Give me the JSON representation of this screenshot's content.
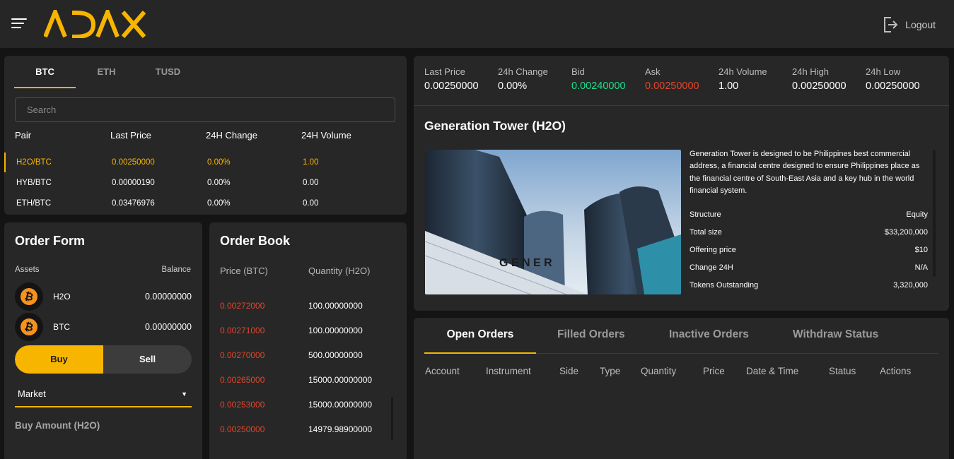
{
  "app": {
    "brand": "ADAX",
    "logout_label": "Logout",
    "accent": "#f7b500",
    "up_color": "#1ae08a",
    "down_color": "#e2452b"
  },
  "markets": {
    "tabs": [
      "BTC",
      "ETH",
      "TUSD"
    ],
    "active_tab": "BTC",
    "search_placeholder": "Search",
    "columns": [
      "Pair",
      "Last Price",
      "24H Change",
      "24H Volume"
    ],
    "rows": [
      {
        "pair": "H2O/BTC",
        "last_price": "0.00250000",
        "change": "0.00%",
        "volume": "1.00"
      },
      {
        "pair": "HYB/BTC",
        "last_price": "0.00000190",
        "change": "0.00%",
        "volume": "0.00"
      },
      {
        "pair": "ETH/BTC",
        "last_price": "0.03476976",
        "change": "0.00%",
        "volume": "0.00"
      }
    ]
  },
  "order_form": {
    "title": "Order Form",
    "assets_label": "Assets",
    "balance_label": "Balance",
    "assets": [
      {
        "icon": "bitcoin-icon",
        "name": "H2O",
        "balance": "0.00000000"
      },
      {
        "icon": "bitcoin-icon",
        "name": "BTC",
        "balance": "0.00000000"
      }
    ],
    "buy_label": "Buy",
    "sell_label": "Sell",
    "order_type": "Market",
    "buy_amount_label": "Buy Amount (H2O)"
  },
  "order_book": {
    "title": "Order Book",
    "price_header": "Price (BTC)",
    "qty_header": "Quantity (H2O)",
    "rows": [
      {
        "price": "0.00272000",
        "qty": "100.00000000"
      },
      {
        "price": "0.00271000",
        "qty": "100.00000000"
      },
      {
        "price": "0.00270000",
        "qty": "500.00000000"
      },
      {
        "price": "0.00265000",
        "qty": "15000.00000000"
      },
      {
        "price": "0.00253000",
        "qty": "15000.00000000"
      },
      {
        "price": "0.00250000",
        "qty": "14979.98900000"
      }
    ]
  },
  "ticker": {
    "last_price": {
      "label": "Last Price",
      "value": "0.00250000"
    },
    "change_24h": {
      "label": "24h Change",
      "value": "0.00%"
    },
    "bid": {
      "label": "Bid",
      "value": "0.00240000"
    },
    "ask": {
      "label": "Ask",
      "value": "0.00250000"
    },
    "volume_24h": {
      "label": "24h Volume",
      "value": "1.00"
    },
    "high_24h": {
      "label": "24h High",
      "value": "0.00250000"
    },
    "low_24h": {
      "label": "24h Low",
      "value": "0.00250000"
    }
  },
  "asset_info": {
    "title": "Generation Tower (H2O)",
    "description": "Generation Tower is designed to be Philippines best commercial address, a financial centre designed to ensure Philippines place as the financial centre of South-East Asia and a key hub in the world financial system.",
    "details": [
      {
        "label": "Structure",
        "value": "Equity"
      },
      {
        "label": "Total size",
        "value": "$33,200,000"
      },
      {
        "label": "Offering price",
        "value": "$10"
      },
      {
        "label": "Change 24H",
        "value": "N/A"
      },
      {
        "label": "Tokens Outstanding",
        "value": "3,320,000"
      }
    ]
  },
  "orders": {
    "tabs": [
      "Open Orders",
      "Filled Orders",
      "Inactive Orders",
      "Withdraw Status"
    ],
    "active_tab": "Open Orders",
    "columns": [
      "Account",
      "Instrument",
      "Side",
      "Type",
      "Quantity",
      "Price",
      "Date & Time",
      "Status",
      "Actions"
    ]
  }
}
